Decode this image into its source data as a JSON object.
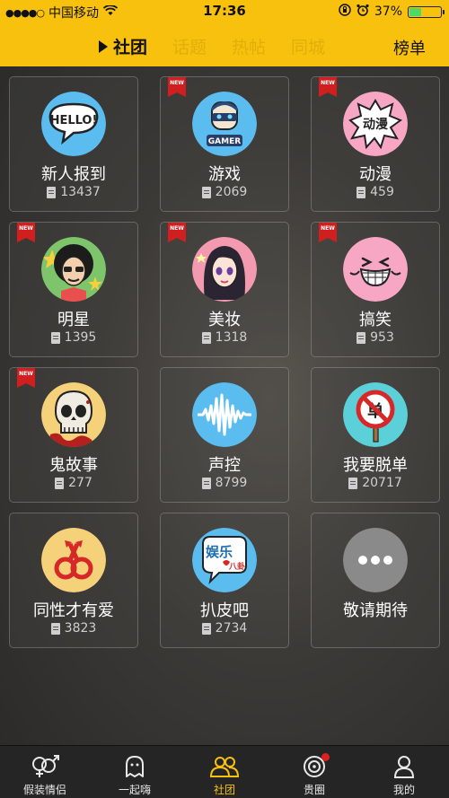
{
  "status": {
    "carrier": "中国移动",
    "time": "17:36",
    "battery_pct": "37%",
    "battery_level": 0.37
  },
  "nav": {
    "tabs": [
      {
        "label": "社团",
        "active": true
      },
      {
        "label": "话题",
        "active": false
      },
      {
        "label": "热帖",
        "active": false
      },
      {
        "label": "同城",
        "active": false
      }
    ],
    "rank_label": "榜单"
  },
  "cards": [
    {
      "name": "新人报到",
      "count": "13437",
      "new": false,
      "icon": "hello-speech-bubble-icon",
      "color": "#5bbcf0"
    },
    {
      "name": "游戏",
      "count": "2069",
      "new": true,
      "icon": "gamer-robot-icon",
      "color": "#5bbcf0"
    },
    {
      "name": "动漫",
      "count": "459",
      "new": true,
      "icon": "manga-burst-icon",
      "color": "#f7a6c4"
    },
    {
      "name": "明星",
      "count": "1395",
      "new": true,
      "icon": "star-celebrity-icon",
      "color": "#7ec46b"
    },
    {
      "name": "美妆",
      "count": "1318",
      "new": true,
      "icon": "makeup-girl-icon",
      "color": "#f49ab0"
    },
    {
      "name": "搞笑",
      "count": "953",
      "new": true,
      "icon": "laughing-face-icon",
      "color": "#f7a6c4"
    },
    {
      "name": "鬼故事",
      "count": "277",
      "new": true,
      "icon": "skull-icon",
      "color": "#f5d27a"
    },
    {
      "name": "声控",
      "count": "8799",
      "new": false,
      "icon": "sound-wave-icon",
      "color": "#5bbcf0"
    },
    {
      "name": "我要脱单",
      "count": "20717",
      "new": false,
      "icon": "no-single-sign-icon",
      "color": "#5bd0d8"
    },
    {
      "name": "同性才有爱",
      "count": "3823",
      "new": false,
      "icon": "male-symbols-icon",
      "color": "#f5d27a"
    },
    {
      "name": "扒皮吧",
      "count": "2734",
      "new": false,
      "icon": "gossip-bubble-icon",
      "color": "#5bbcf0"
    },
    {
      "name": "敬请期待",
      "count": "",
      "new": false,
      "icon": "more-dots-icon",
      "color": "#8a8a8a"
    }
  ],
  "new_badge": "NEW",
  "icon_text": {
    "hello": "HELLO!",
    "gamer": "GAMER",
    "manga": "动漫",
    "gossip_main": "娱乐",
    "gossip_sub": "八卦",
    "single": "单"
  },
  "tabbar": [
    {
      "label": "假装情侣",
      "icon": "gender-symbols-icon",
      "active": false
    },
    {
      "label": "一起嗨",
      "icon": "ghost-icon",
      "active": false
    },
    {
      "label": "社团",
      "icon": "group-people-icon",
      "active": true
    },
    {
      "label": "贵圈",
      "icon": "record-circle-icon",
      "active": false,
      "badge": true
    },
    {
      "label": "我的",
      "icon": "person-icon",
      "active": false
    }
  ]
}
